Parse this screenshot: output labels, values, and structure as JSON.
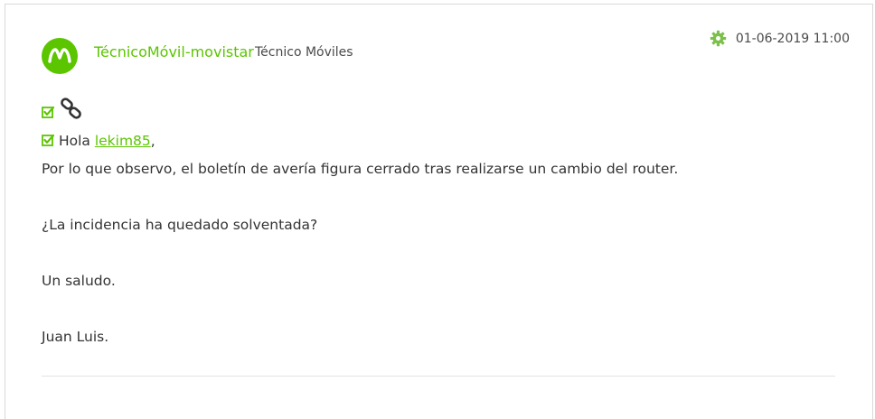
{
  "post": {
    "author": "TécnicoMóvil-movistar",
    "role": "Técnico Móviles",
    "timestamp": "01-06-2019 11:00",
    "avatar_icon": "movistar-m-logo",
    "greeting_prefix": "Hola ",
    "mention": "lekim85",
    "greeting_suffix": ",",
    "paragraphs": [
      "Por lo que observo, el boletín de avería figura cerrado tras realizarse un cambio del router.",
      "¿La incidencia ha quedado solventada?",
      "Un saludo.",
      "Juan Luis."
    ]
  },
  "icons": {
    "settings": "gear-icon",
    "check": "checkbox-checked-icon",
    "link": "link-chain-icon"
  },
  "colors": {
    "accent": "#5bc500",
    "text": "#333333",
    "muted": "#4a4a4a"
  }
}
